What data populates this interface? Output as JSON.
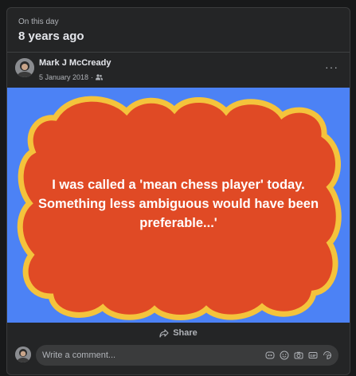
{
  "memory": {
    "label": "On this day",
    "title": "8 years ago"
  },
  "post": {
    "author": "Mark J McCready",
    "date": "5 January 2018",
    "audience_icon": "friends-icon",
    "more_label": "···",
    "image_text": "I was called a 'mean chess player' today. Something less ambiguous would have been preferable...'",
    "image_colors": {
      "background": "#4c82f5",
      "bubble": "#e04a25",
      "outline": "#f4c33c"
    }
  },
  "actions": {
    "share_label": "Share"
  },
  "comment": {
    "placeholder": "Write a comment...",
    "icons": [
      "avatar-sticker-icon",
      "emoji-icon",
      "camera-icon",
      "gif-icon",
      "sticker-icon"
    ]
  }
}
